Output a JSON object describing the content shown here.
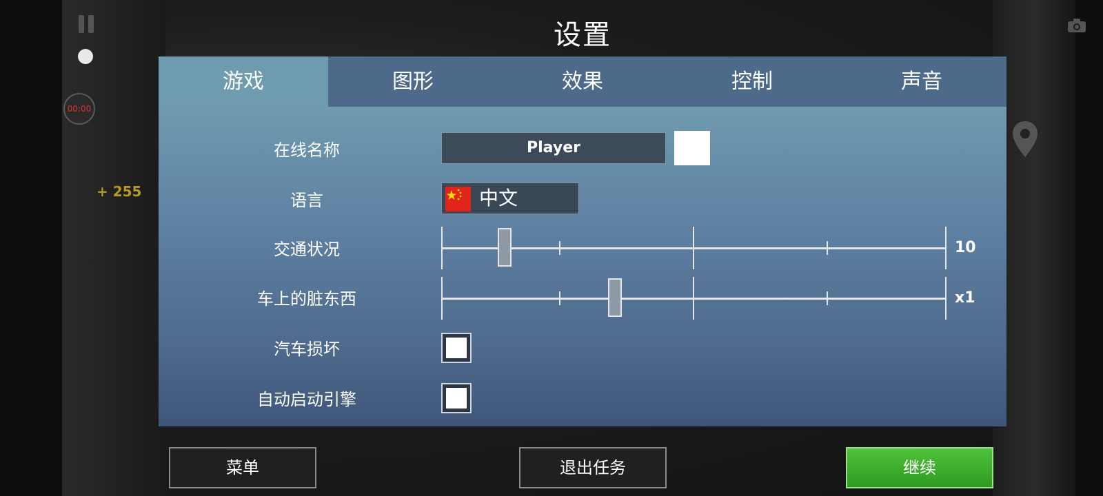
{
  "page": {
    "title": "设置"
  },
  "hud": {
    "timer": "00:00",
    "score": "+ 255"
  },
  "tabs": [
    {
      "label": "游戏",
      "active": true
    },
    {
      "label": "图形",
      "active": false
    },
    {
      "label": "效果",
      "active": false
    },
    {
      "label": "控制",
      "active": false
    },
    {
      "label": "声音",
      "active": false
    }
  ],
  "settings": {
    "online_name": {
      "label": "在线名称",
      "value": "Player"
    },
    "language": {
      "label": "语言",
      "value": "中文"
    },
    "traffic": {
      "label": "交通状况",
      "value_text": "10",
      "position": 0.115
    },
    "dirt": {
      "label": "车上的脏东西",
      "value_text": "x1",
      "position": 0.34
    },
    "car_damage": {
      "label": "汽车损坏",
      "checked": false
    },
    "auto_start": {
      "label": "自动启动引擎",
      "checked": false
    }
  },
  "buttons": {
    "menu": "菜单",
    "quit": "退出任务",
    "continue": "继续"
  },
  "colors": {
    "accent_green": "#3fae2e",
    "panel_blue": "#4e6a8a",
    "active_tab": "#6e9cae"
  }
}
